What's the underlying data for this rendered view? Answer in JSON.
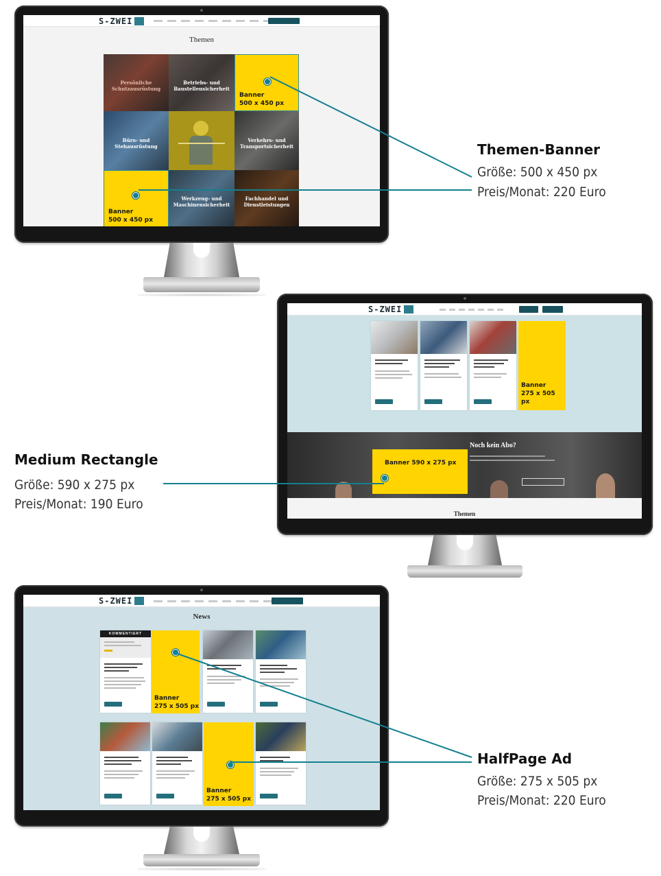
{
  "logo": "S-ZWEI",
  "monitor1": {
    "title": "Themen",
    "tiles": [
      "Persönliche Schutzausrüstung",
      "Betriebs- und Baustellensicherheit",
      "Büro- und Stehausrüstung",
      "",
      "Verkehrs- und Transportsicherheit",
      "",
      "Werkzeug- und Maschinensicherheit",
      "Fachhandel und Dienstleistungen"
    ],
    "banner_top": {
      "line1": "Banner",
      "line2": "500 x 450 px"
    },
    "banner_bottom": {
      "line1": "Banner",
      "line2": "500 x 450 px"
    }
  },
  "monitor2": {
    "banner_half": {
      "line1": "Banner",
      "line2": "275 x 505 px"
    },
    "banner_medium": "Banner 590 x 275 px",
    "promo_title": "Noch kein Abo?",
    "section_title": "Themen"
  },
  "monitor3": {
    "title": "News",
    "tag": "KOMMENTIERT",
    "banner_a": {
      "line1": "Banner",
      "line2": "275 x 505 px"
    },
    "banner_b": {
      "line1": "Banner",
      "line2": "275 x 505 px"
    }
  },
  "callouts": {
    "themen": {
      "title": "Themen-Banner",
      "size": "Größe: 500 x 450 px",
      "price": "Preis/Monat: 220 Euro"
    },
    "medium": {
      "title": "Medium Rectangle",
      "size": "Größe: 590 x 275 px",
      "price": "Preis/Monat: 190 Euro"
    },
    "halfpage": {
      "title": "HalfPage Ad",
      "size": "Größe: 275 x 505 px",
      "price": "Preis/Monat: 220 Euro"
    }
  },
  "colors": {
    "banner": "#ffd400",
    "accent": "#13808f",
    "light_blue": "#cfe1e6",
    "bezel": "#151515"
  }
}
